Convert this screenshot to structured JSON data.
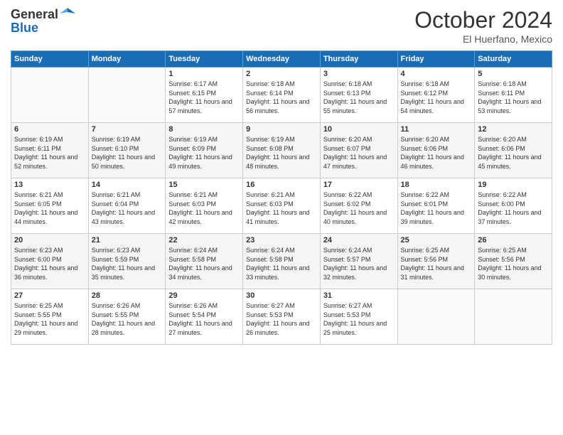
{
  "header": {
    "logo_line1": "General",
    "logo_line2": "Blue",
    "month": "October 2024",
    "location": "El Huerfano, Mexico"
  },
  "days_of_week": [
    "Sunday",
    "Monday",
    "Tuesday",
    "Wednesday",
    "Thursday",
    "Friday",
    "Saturday"
  ],
  "weeks": [
    [
      null,
      null,
      {
        "day": 1,
        "sunrise": "6:17 AM",
        "sunset": "6:15 PM",
        "daylight": "11 hours and 57 minutes."
      },
      {
        "day": 2,
        "sunrise": "6:18 AM",
        "sunset": "6:14 PM",
        "daylight": "11 hours and 56 minutes."
      },
      {
        "day": 3,
        "sunrise": "6:18 AM",
        "sunset": "6:13 PM",
        "daylight": "11 hours and 55 minutes."
      },
      {
        "day": 4,
        "sunrise": "6:18 AM",
        "sunset": "6:12 PM",
        "daylight": "11 hours and 54 minutes."
      },
      {
        "day": 5,
        "sunrise": "6:18 AM",
        "sunset": "6:11 PM",
        "daylight": "11 hours and 53 minutes."
      }
    ],
    [
      {
        "day": 6,
        "sunrise": "6:19 AM",
        "sunset": "6:11 PM",
        "daylight": "11 hours and 52 minutes."
      },
      {
        "day": 7,
        "sunrise": "6:19 AM",
        "sunset": "6:10 PM",
        "daylight": "11 hours and 50 minutes."
      },
      {
        "day": 8,
        "sunrise": "6:19 AM",
        "sunset": "6:09 PM",
        "daylight": "11 hours and 49 minutes."
      },
      {
        "day": 9,
        "sunrise": "6:19 AM",
        "sunset": "6:08 PM",
        "daylight": "11 hours and 48 minutes."
      },
      {
        "day": 10,
        "sunrise": "6:20 AM",
        "sunset": "6:07 PM",
        "daylight": "11 hours and 47 minutes."
      },
      {
        "day": 11,
        "sunrise": "6:20 AM",
        "sunset": "6:06 PM",
        "daylight": "11 hours and 46 minutes."
      },
      {
        "day": 12,
        "sunrise": "6:20 AM",
        "sunset": "6:06 PM",
        "daylight": "11 hours and 45 minutes."
      }
    ],
    [
      {
        "day": 13,
        "sunrise": "6:21 AM",
        "sunset": "6:05 PM",
        "daylight": "11 hours and 44 minutes."
      },
      {
        "day": 14,
        "sunrise": "6:21 AM",
        "sunset": "6:04 PM",
        "daylight": "11 hours and 43 minutes."
      },
      {
        "day": 15,
        "sunrise": "6:21 AM",
        "sunset": "6:03 PM",
        "daylight": "11 hours and 42 minutes."
      },
      {
        "day": 16,
        "sunrise": "6:21 AM",
        "sunset": "6:03 PM",
        "daylight": "11 hours and 41 minutes."
      },
      {
        "day": 17,
        "sunrise": "6:22 AM",
        "sunset": "6:02 PM",
        "daylight": "11 hours and 40 minutes."
      },
      {
        "day": 18,
        "sunrise": "6:22 AM",
        "sunset": "6:01 PM",
        "daylight": "11 hours and 39 minutes."
      },
      {
        "day": 19,
        "sunrise": "6:22 AM",
        "sunset": "6:00 PM",
        "daylight": "11 hours and 37 minutes."
      }
    ],
    [
      {
        "day": 20,
        "sunrise": "6:23 AM",
        "sunset": "6:00 PM",
        "daylight": "11 hours and 36 minutes."
      },
      {
        "day": 21,
        "sunrise": "6:23 AM",
        "sunset": "5:59 PM",
        "daylight": "11 hours and 35 minutes."
      },
      {
        "day": 22,
        "sunrise": "6:24 AM",
        "sunset": "5:58 PM",
        "daylight": "11 hours and 34 minutes."
      },
      {
        "day": 23,
        "sunrise": "6:24 AM",
        "sunset": "5:58 PM",
        "daylight": "11 hours and 33 minutes."
      },
      {
        "day": 24,
        "sunrise": "6:24 AM",
        "sunset": "5:57 PM",
        "daylight": "11 hours and 32 minutes."
      },
      {
        "day": 25,
        "sunrise": "6:25 AM",
        "sunset": "5:56 PM",
        "daylight": "11 hours and 31 minutes."
      },
      {
        "day": 26,
        "sunrise": "6:25 AM",
        "sunset": "5:56 PM",
        "daylight": "11 hours and 30 minutes."
      }
    ],
    [
      {
        "day": 27,
        "sunrise": "6:25 AM",
        "sunset": "5:55 PM",
        "daylight": "11 hours and 29 minutes."
      },
      {
        "day": 28,
        "sunrise": "6:26 AM",
        "sunset": "5:55 PM",
        "daylight": "11 hours and 28 minutes."
      },
      {
        "day": 29,
        "sunrise": "6:26 AM",
        "sunset": "5:54 PM",
        "daylight": "11 hours and 27 minutes."
      },
      {
        "day": 30,
        "sunrise": "6:27 AM",
        "sunset": "5:53 PM",
        "daylight": "11 hours and 26 minutes."
      },
      {
        "day": 31,
        "sunrise": "6:27 AM",
        "sunset": "5:53 PM",
        "daylight": "11 hours and 25 minutes."
      },
      null,
      null
    ]
  ]
}
